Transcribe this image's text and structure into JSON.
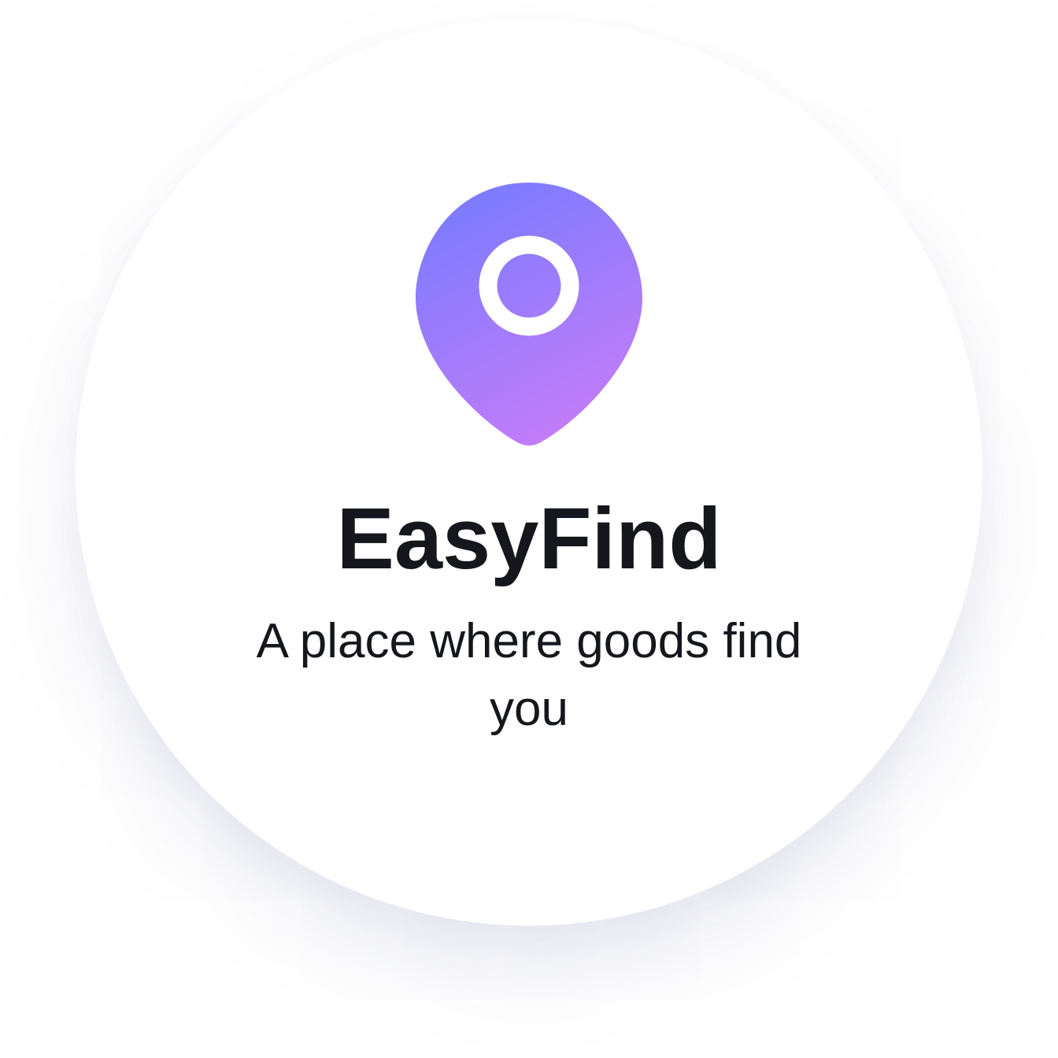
{
  "app": {
    "name": "EasyFind",
    "tagline": "A place where goods find you"
  },
  "logo": {
    "icon": "location-pin-icon",
    "gradient_start": "#7B7BFF",
    "gradient_end": "#C87CF8",
    "ring_color": "#FFFFFF"
  },
  "colors": {
    "background": "#FFFFFF",
    "text": "#15171C"
  }
}
